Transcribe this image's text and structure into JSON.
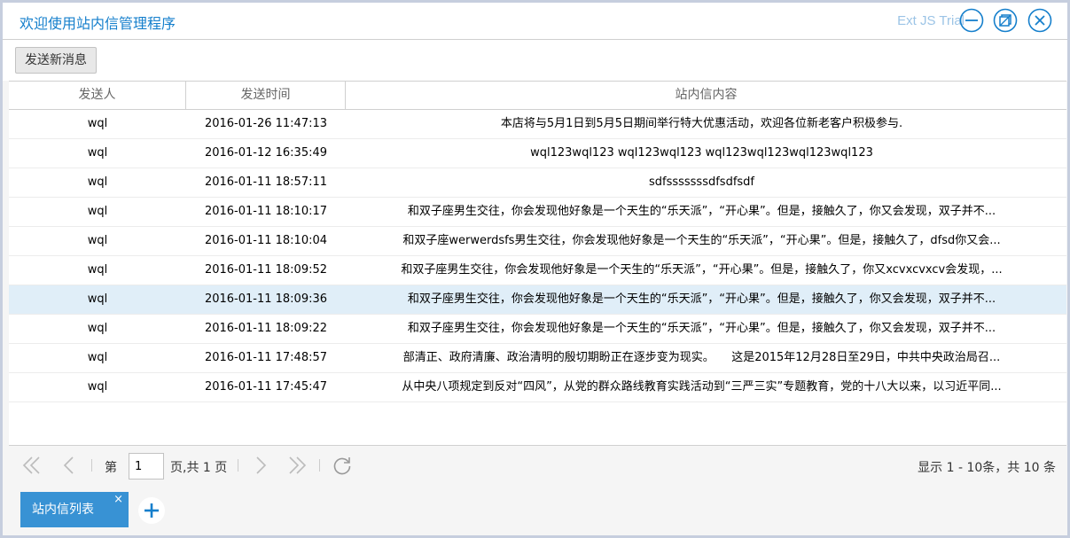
{
  "window": {
    "title": "欢迎使用站内信管理程序",
    "trial_label": "Ext JS Trial",
    "tools": [
      "minimize-icon",
      "restore-icon",
      "close-icon"
    ]
  },
  "toolbar": {
    "send_label": "发送新消息"
  },
  "grid": {
    "columns": [
      "发送人",
      "发送时间",
      "站内信内容"
    ],
    "rows": [
      {
        "sender": "wql",
        "time": "2016-01-26 11:47:13",
        "content": "本店将与5月1日到5月5日期间举行特大优惠活动，欢迎各位新老客户积极参与."
      },
      {
        "sender": "wql",
        "time": "2016-01-12 16:35:49",
        "content": "wql123wql123 wql123wql123 wql123wql123wql123wql123"
      },
      {
        "sender": "wql",
        "time": "2016-01-11 18:57:11",
        "content": "sdfsssssssdfsdfsdf"
      },
      {
        "sender": "wql",
        "time": "2016-01-11 18:10:17",
        "content": "和双子座男生交往，你会发现他好象是一个天生的“乐天派”，“开心果”。但是，接触久了，你又会发现，双子并不..."
      },
      {
        "sender": "wql",
        "time": "2016-01-11 18:10:04",
        "content": "和双子座werwerdsfs男生交往，你会发现他好象是一个天生的“乐天派”，“开心果”。但是，接触久了，dfsd你又会..."
      },
      {
        "sender": "wql",
        "time": "2016-01-11 18:09:52",
        "content": "和双子座男生交往，你会发现他好象是一个天生的“乐天派”，“开心果”。但是，接触久了，你又xcvxcvxcv会发现，..."
      },
      {
        "sender": "wql",
        "time": "2016-01-11 18:09:36",
        "content": "和双子座男生交往，你会发现他好象是一个天生的“乐天派”，“开心果”。但是，接触久了，你又会发现，双子并不..."
      },
      {
        "sender": "wql",
        "time": "2016-01-11 18:09:22",
        "content": "和双子座男生交往，你会发现他好象是一个天生的“乐天派”，“开心果”。但是，接触久了，你又会发现，双子并不..."
      },
      {
        "sender": "wql",
        "time": "2016-01-11 17:48:57",
        "content": "部清正、政府清廉、政治清明的殷切期盼正在逐步变为现实。　　这是2015年12月28日至29日，中共中央政治局召..."
      },
      {
        "sender": "wql",
        "time": "2016-01-11 17:45:47",
        "content": "从中央八项规定到反对“四风”，从党的群众路线教育实践活动到“三严三实”专题教育，党的十八大以来，以习近平同..."
      }
    ],
    "selected_row": 6
  },
  "pager": {
    "page_prefix": "第",
    "page_value": "1",
    "page_suffix": "页,共 1 页",
    "display_text": "显示 1 - 10条，共 10 条",
    "icons": [
      "first-page-icon",
      "prev-page-icon",
      "next-page-icon",
      "last-page-icon",
      "refresh-icon"
    ]
  },
  "tabs": {
    "items": [
      {
        "label": "站内信列表",
        "close": "×"
      }
    ],
    "add_icon": "plus-icon"
  },
  "colors": {
    "accent": "#157fcc",
    "tab": "#3892d4",
    "selected_row": "#e0eef8"
  }
}
